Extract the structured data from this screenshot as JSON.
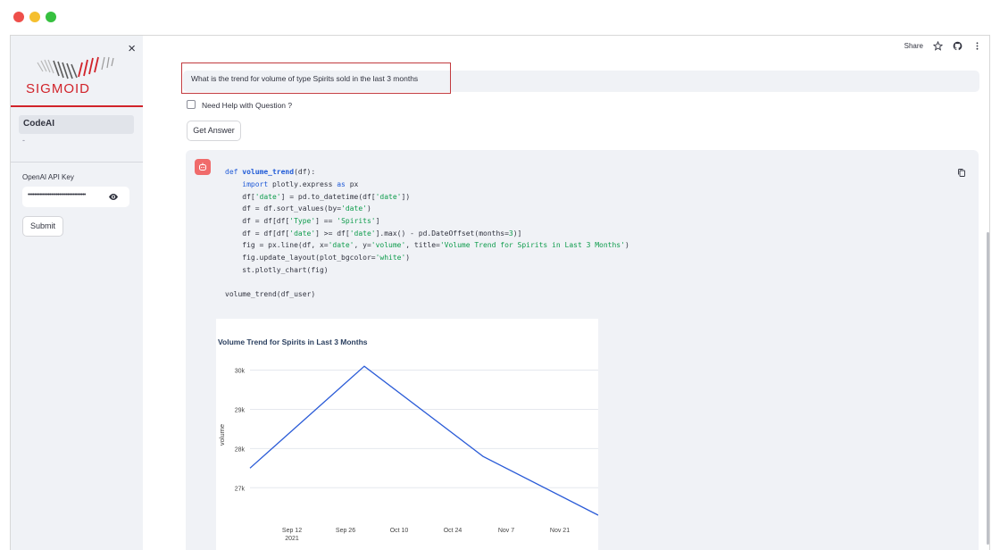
{
  "sidebar": {
    "close_glyph": "×",
    "logo_text": "SIGMOID",
    "nav_item": "CodeAI",
    "nav_sub": "-",
    "api_key_label": "OpenAI API Key",
    "api_key_value": "•••••••••••••••••••••••••••••••••••",
    "submit_label": "Submit",
    "brand_color": "#d1232a"
  },
  "header": {
    "share_label": "Share",
    "icons": [
      "star-icon",
      "github-icon",
      "more-vertical-icon"
    ]
  },
  "main": {
    "question": "What is the trend for volume of  type Spirits sold in the last 3 months",
    "help_label": "Need Help with Question ?",
    "help_checked": false,
    "get_answer_label": "Get Answer"
  },
  "code": {
    "lines": [
      "def volume_trend(df):",
      "    import plotly.express as px",
      "    df['date'] = pd.to_datetime(df['date'])",
      "    df = df.sort_values(by='date')",
      "    df = df[df['Type'] == 'Spirits']",
      "    df = df[df['date'] >= df['date'].max() - pd.DateOffset(months=3)]",
      "    fig = px.line(df, x='date', y='volume', title='Volume Trend for Spirits in Last 3 Months')",
      "    fig.update_layout(plot_bgcolor='white')",
      "    st.plotly_chart(fig)",
      "",
      "volume_trend(df_user)"
    ]
  },
  "chart_data": {
    "type": "line",
    "title": "Volume Trend for Spirits in Last 3 Months",
    "xlabel": "",
    "ylabel": "volume",
    "x": [
      "2021-09-01",
      "2021-10-01",
      "2021-11-01",
      "2021-12-01"
    ],
    "series": [
      {
        "values": [
          27500,
          30100,
          27800,
          26300
        ]
      }
    ],
    "x_ticks": [
      "Sep 12\n2021",
      "Sep 26",
      "Oct 10",
      "Oct 24",
      "Nov 7",
      "Nov 21"
    ],
    "y_ticks": [
      "27k",
      "28k",
      "29k",
      "30k"
    ],
    "ylim": [
      26300,
      30400
    ],
    "grid": true,
    "line_color": "#2a5bd7"
  }
}
